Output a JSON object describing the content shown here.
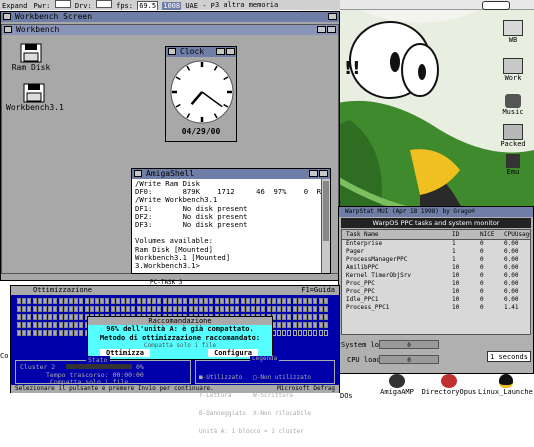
{
  "top_bar": {
    "expand": "Expand",
    "pwr": "Pwr:",
    "drv": "Drv:",
    "fps": "fps:",
    "fps_value": "69.5",
    "year": "1008",
    "mem_text": "3 altra memoria",
    "uae_text": "UAE - Power [0] Drive: [ ] [ ] [ ] [ ]"
  },
  "wb_screen": {
    "title": "Workbench Screen",
    "window_title": "Workbench",
    "icons": [
      {
        "label": "Ram Disk"
      },
      {
        "label": "Workbench3.1"
      }
    ]
  },
  "clock": {
    "title": "Clock",
    "date": "04/29/00",
    "hour": 7.0,
    "minute": 21
  },
  "shell": {
    "title": "AmigaShell",
    "lines": [
      "/Write Ram Disk",
      "DF0:       879K    1712     46  97%    0  Read",
      "/Write Workbench3.1",
      "DF1:       No disk present",
      "DF2:       No disk present",
      "DF3:       No disk present",
      "",
      "Volumes available:",
      "Ram Disk [Mounted]",
      "Workbench3.1 [Mounted]",
      "3.Workbench3.1>"
    ],
    "status": "PC-TASK 3"
  },
  "defrag": {
    "title": "Ottimizzazione",
    "help": "F1=Guida",
    "dialog_title": "Raccomandazione",
    "dialog_line1": "96% dell'unità A: è già compattato.",
    "dialog_line2": "Metodo di ottimizzazione raccomandato:",
    "dialog_line3": "Compatta solo i file",
    "btn_optimize": "Ottimizza",
    "btn_configure": "Configura",
    "status_header": "Stato",
    "status_cluster": "Cluster 2",
    "status_pct": "0%",
    "status_time": "Tempo trascorso: 00:00:00",
    "status_method": "Compatta solo i file",
    "legend_header": "Legenda",
    "legend_items": [
      "■-Utilizzato   □-Non utilizzato",
      "r-Lettura      W-Scrittura",
      "B-Danneggiato  X-Non rilocabile",
      "Unità A: 1 blocco = 1 cluster"
    ],
    "bottom_left": "Selezionare il pulsante e premere Invio per continuare.",
    "bottom_right": "Microsoft Defrag"
  },
  "warp": {
    "title": "WarpStat MUI (Apr 18 1998) by Grago®",
    "subtitle": "WarpOS PPC tasks and system monitor",
    "headers": [
      "Task Name",
      "ID",
      "NICE",
      "CPUUsage"
    ],
    "rows": [
      {
        "name": "Enterprise",
        "id": "1",
        "nice": "0",
        "cpu": "0.00"
      },
      {
        "name": "Pager",
        "id": "1",
        "nice": "0",
        "cpu": "0.00"
      },
      {
        "name": "ProcessManagerPPC",
        "id": "1",
        "nice": "0",
        "cpu": "0.00"
      },
      {
        "name": "AmilibPPC",
        "id": "10",
        "nice": "0",
        "cpu": "0.00"
      },
      {
        "name": "Kernel TimerObjSrv",
        "id": "10",
        "nice": "0",
        "cpu": "0.00"
      },
      {
        "name": "Proc_PPC",
        "id": "10",
        "nice": "0",
        "cpu": "0.00"
      },
      {
        "name": "Proc_PPC",
        "id": "10",
        "nice": "0",
        "cpu": "0.00"
      },
      {
        "name": "Idle_PPC1",
        "id": "10",
        "nice": "0",
        "cpu": "0.00"
      },
      {
        "name": "Process_PPC1",
        "id": "10",
        "nice": "0",
        "cpu": "1.41"
      }
    ],
    "system_load_label": "System load:",
    "cpu_load_label": "CPU load:",
    "load_value": "0",
    "interval": "1 seconds"
  },
  "right_dock": [
    {
      "label": "WB",
      "icon": "wb-icon"
    },
    {
      "label": "Work",
      "icon": "drawer-icon"
    },
    {
      "label": "Music",
      "icon": "music-icon"
    },
    {
      "label": "Packed",
      "icon": "box-icon"
    },
    {
      "label": "Emu",
      "icon": "emu-icon"
    }
  ],
  "bottom_icons": [
    {
      "label": "AmigaAMP"
    },
    {
      "label": "DirectoryOpus"
    },
    {
      "label": "Linux_Launcher"
    }
  ],
  "left_edge_label": "Co",
  "left_edge_label2": "DOs",
  "cartoon_text": "!!",
  "colors": {
    "amiga_gray": "#a8a8a8",
    "title_blue": "#6f7ea6",
    "defrag_blue": "#0000aa",
    "dialog_cyan": "#55ffff",
    "cartoon_green": "#3e8a2c"
  }
}
